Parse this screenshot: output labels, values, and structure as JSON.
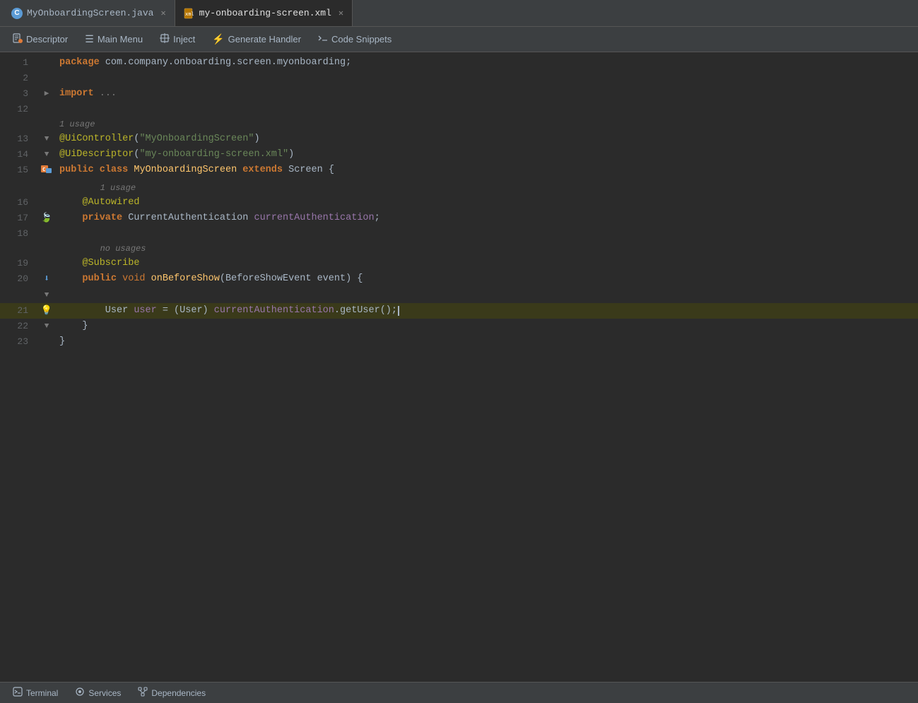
{
  "tabs": [
    {
      "id": "java",
      "label": "MyOnboardingScreen.java",
      "icon": "java",
      "active": false
    },
    {
      "id": "xml",
      "label": "my-onboarding-screen.xml",
      "icon": "xml",
      "active": true
    }
  ],
  "toolbar": {
    "buttons": [
      {
        "id": "descriptor",
        "icon": "📄",
        "label": "Descriptor"
      },
      {
        "id": "main-menu",
        "icon": "☰",
        "label": "Main Menu"
      },
      {
        "id": "inject",
        "icon": "💉",
        "label": "Inject"
      },
      {
        "id": "generate-handler",
        "icon": "⚡",
        "label": "Generate Handler"
      },
      {
        "id": "code-snippets",
        "icon": "📎",
        "label": "Code Snippets"
      }
    ]
  },
  "code": {
    "lines": [
      {
        "num": 1,
        "type": "code",
        "content": "package com.company.onboarding.screen.myonboarding;"
      },
      {
        "num": 2,
        "type": "empty"
      },
      {
        "num": 3,
        "type": "code",
        "collapsed": true,
        "content": "import ..."
      },
      {
        "num": 12,
        "type": "empty"
      },
      {
        "num": null,
        "type": "annotation-text",
        "content": "1 usage"
      },
      {
        "num": 13,
        "type": "code",
        "content": "@UiController(\"MyOnboardingScreen\")"
      },
      {
        "num": 14,
        "type": "code",
        "content": "@UiDescriptor(\"my-onboarding-screen.xml\")"
      },
      {
        "num": 15,
        "type": "code",
        "gutter": "class",
        "content": "public class MyOnboardingScreen extends Screen {"
      },
      {
        "num": null,
        "type": "annotation-text",
        "content": "1 usage",
        "indent": true
      },
      {
        "num": 16,
        "type": "code",
        "indent": true,
        "content": "@Autowired"
      },
      {
        "num": 17,
        "type": "code",
        "indent": true,
        "gutter": "leaf",
        "content": "private CurrentAuthentication currentAuthentication;"
      },
      {
        "num": 18,
        "type": "empty"
      },
      {
        "num": null,
        "type": "annotation-text",
        "content": "no usages",
        "indent": true
      },
      {
        "num": 19,
        "type": "code",
        "indent": true,
        "content": "@Subscribe"
      },
      {
        "num": 20,
        "type": "code",
        "indent": true,
        "gutter": "download",
        "collapsed": true,
        "content": "public void onBeforeShow(BeforeShowEvent event) {"
      },
      {
        "num": 21,
        "type": "code",
        "indent2": true,
        "gutter": "lightbulb",
        "highlighted": true,
        "content": "User user = (User) currentAuthentication.getUser();"
      },
      {
        "num": 22,
        "type": "code",
        "indent": true,
        "collapsed": true,
        "content": "}"
      },
      {
        "num": 23,
        "type": "code",
        "content": "}"
      }
    ]
  },
  "statusbar": {
    "items": [
      {
        "id": "terminal",
        "icon": "terminal",
        "label": "Terminal"
      },
      {
        "id": "services",
        "icon": "services",
        "label": "Services"
      },
      {
        "id": "dependencies",
        "icon": "dependencies",
        "label": "Dependencies"
      }
    ]
  }
}
